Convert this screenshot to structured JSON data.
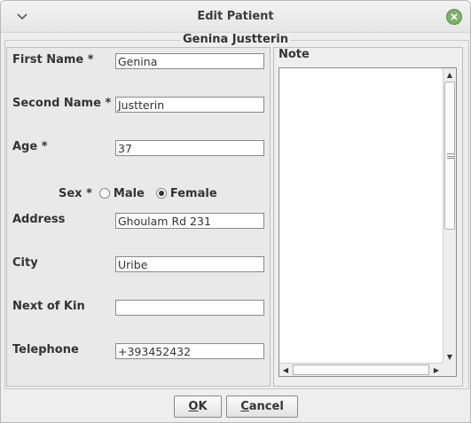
{
  "window": {
    "title": "Edit Patient",
    "menu_icon": "chevron-down-icon",
    "close_icon": "close-icon",
    "close_color": "#7fb26a"
  },
  "group_title": "Genina Justterin",
  "form": {
    "first_name": {
      "label": "First Name *",
      "value": "Genina"
    },
    "second_name": {
      "label": "Second Name *",
      "value": "Justterin"
    },
    "age": {
      "label": "Age *",
      "value": "37"
    },
    "sex": {
      "label": "Sex *",
      "options": [
        "Male",
        "Female"
      ],
      "selected": "Female"
    },
    "address": {
      "label": "Address",
      "value": "Ghoulam Rd 231"
    },
    "city": {
      "label": "City",
      "value": "Uribe"
    },
    "next_of_kin": {
      "label": "Next of Kin",
      "value": ""
    },
    "telephone": {
      "label": "Telephone",
      "value": "+393452432"
    }
  },
  "note": {
    "label": "Note",
    "value": ""
  },
  "buttons": {
    "ok": {
      "mnemonic": "O",
      "rest": "K"
    },
    "cancel": {
      "mnemonic": "C",
      "rest": "ancel"
    }
  }
}
